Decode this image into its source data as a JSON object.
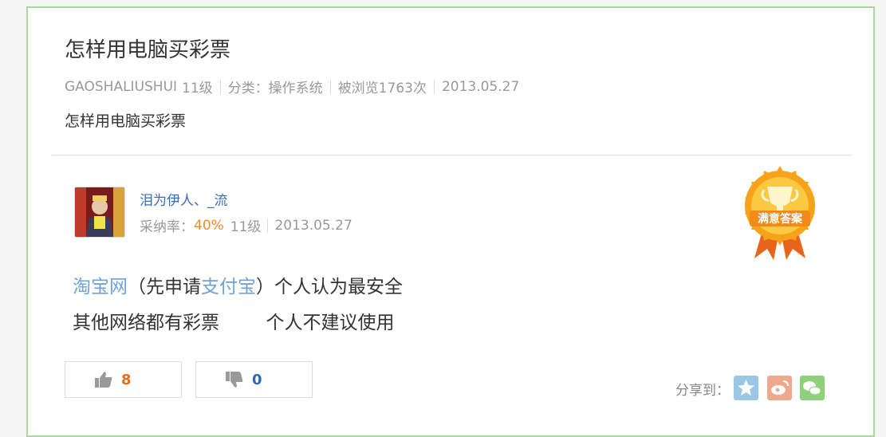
{
  "question": {
    "title": "怎样用电脑买彩票",
    "author": "GAOSHALIUSHUI",
    "author_level": "11级",
    "category": "分类：操作系统",
    "views": "被浏览1763次",
    "date": "2013.05.27",
    "description": "怎样用电脑买彩票"
  },
  "answer": {
    "username": "泪为伊人、_流",
    "adoption_label": "采纳率：",
    "adoption_rate": "40%",
    "level": "11级",
    "date": "2013.05.27",
    "badge_text": "满意答案",
    "line1_link1": "淘宝网",
    "line1_mid": "（先申请",
    "line1_link2": "支付宝",
    "line1_end": "）个人认为最安全",
    "line2": "其他网络都有彩票        个人不建议使用",
    "upvotes": "8",
    "downvotes": "0",
    "share_label": "分享到："
  },
  "colors": {
    "border": "#a8d8a0",
    "link": "#6ea2d8",
    "rate": "#f08a2c",
    "up_count": "#e07020",
    "down_count": "#2a6ab8"
  }
}
